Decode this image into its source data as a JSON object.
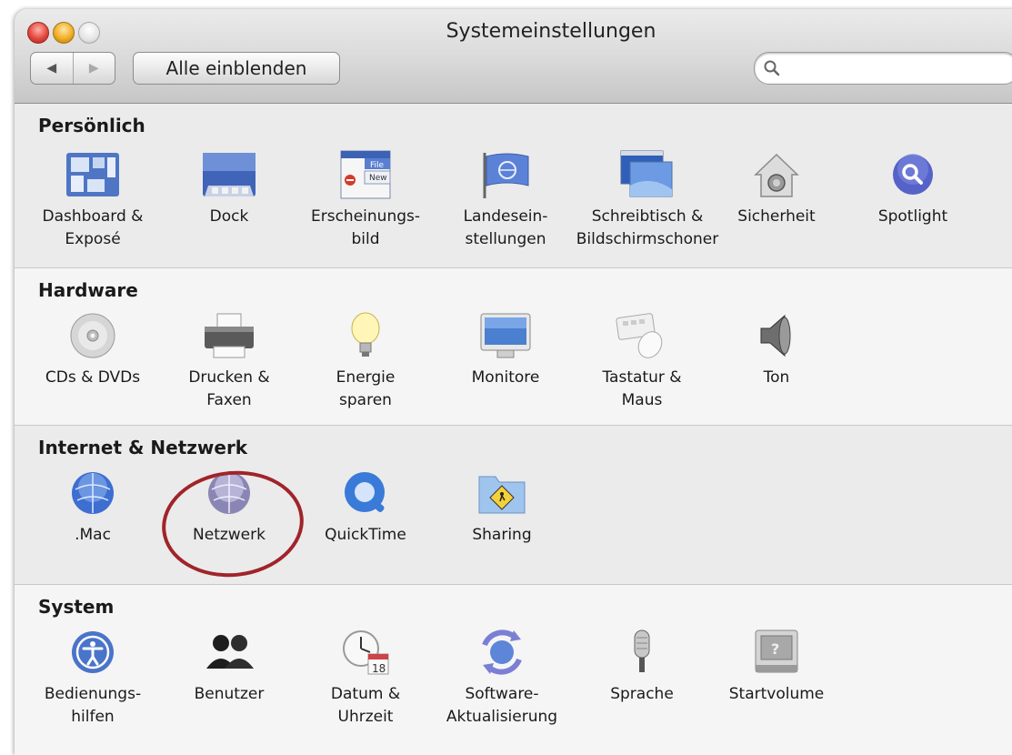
{
  "window": {
    "title": "Systemeinstellungen"
  },
  "toolbar": {
    "back_glyph": "◀",
    "forward_glyph": "▶",
    "show_all_label": "Alle einblenden",
    "search_placeholder": "",
    "search_value": ""
  },
  "sections": [
    {
      "title": "Persönlich",
      "items": [
        {
          "line1": "Dashboard &",
          "line2": "Exposé",
          "icon": "dashboard-icon"
        },
        {
          "line1": "Dock",
          "line2": "",
          "icon": "dock-icon"
        },
        {
          "line1": "Erscheinungs-",
          "line2": "bild",
          "icon": "appearance-icon",
          "icon_text_top": "File",
          "icon_text_bottom": "New"
        },
        {
          "line1": "Landesein-",
          "line2": "stellungen",
          "icon": "international-flag-icon"
        },
        {
          "line1": "Schreibtisch &",
          "line2": "Bildschirmschoner",
          "icon": "desktop-icon"
        },
        {
          "line1": "Sicherheit",
          "line2": "",
          "icon": "security-house-icon"
        },
        {
          "line1": "Spotlight",
          "line2": "",
          "icon": "spotlight-icon"
        }
      ]
    },
    {
      "title": "Hardware",
      "items": [
        {
          "line1": "CDs & DVDs",
          "line2": "",
          "icon": "cd-icon"
        },
        {
          "line1": "Drucken &",
          "line2": "Faxen",
          "icon": "printer-icon"
        },
        {
          "line1": "Energie",
          "line2": "sparen",
          "icon": "light-bulb-icon"
        },
        {
          "line1": "Monitore",
          "line2": "",
          "icon": "monitor-icon"
        },
        {
          "line1": "Tastatur &",
          "line2": "Maus",
          "icon": "keyboard-mouse-icon"
        },
        {
          "line1": "Ton",
          "line2": "",
          "icon": "speaker-icon"
        }
      ]
    },
    {
      "title": "Internet & Netzwerk",
      "items": [
        {
          "line1": ".Mac",
          "line2": "",
          "icon": "dotmac-globe-icon"
        },
        {
          "line1": "Netzwerk",
          "line2": "",
          "icon": "network-globe-icon"
        },
        {
          "line1": "QuickTime",
          "line2": "",
          "icon": "quicktime-icon"
        },
        {
          "line1": "Sharing",
          "line2": "",
          "icon": "sharing-folder-icon"
        }
      ]
    },
    {
      "title": "System",
      "items": [
        {
          "line1": "Bedienungs-",
          "line2": "hilfen",
          "icon": "accessibility-icon"
        },
        {
          "line1": "Benutzer",
          "line2": "",
          "icon": "users-icon"
        },
        {
          "line1": "Datum &",
          "line2": "Uhrzeit",
          "icon": "clock-calendar-icon",
          "icon_text": "18"
        },
        {
          "line1": "Software-",
          "line2": "Aktualisierung",
          "icon": "software-update-icon"
        },
        {
          "line1": "Sprache",
          "line2": "",
          "icon": "microphone-icon"
        },
        {
          "line1": "Startvolume",
          "line2": "",
          "icon": "startup-disk-icon",
          "icon_text": "?"
        }
      ]
    }
  ],
  "highlight": {
    "target": "Netzwerk",
    "color": "#a0242a"
  }
}
